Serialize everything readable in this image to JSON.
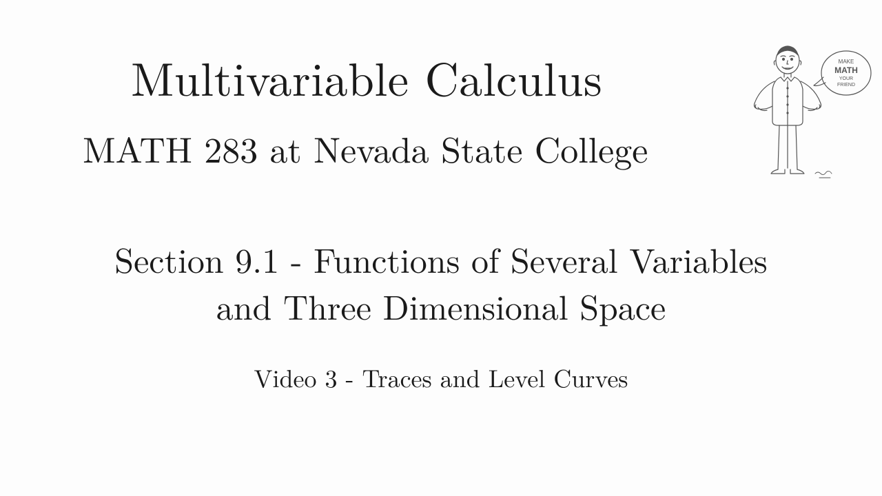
{
  "title": "Multivariable Calculus",
  "subtitle": "MATH 283 at Nevada State College",
  "section_line1": "Section 9.1 - Functions of Several Variables",
  "section_line2": "and Three Dimensional Space",
  "video": "Video 3 - Traces and Level Curves",
  "mascot": {
    "bubble_line1": "MAKE",
    "bubble_line2": "MATH",
    "bubble_line3": "YOUR",
    "bubble_line4": "FRIEND"
  }
}
